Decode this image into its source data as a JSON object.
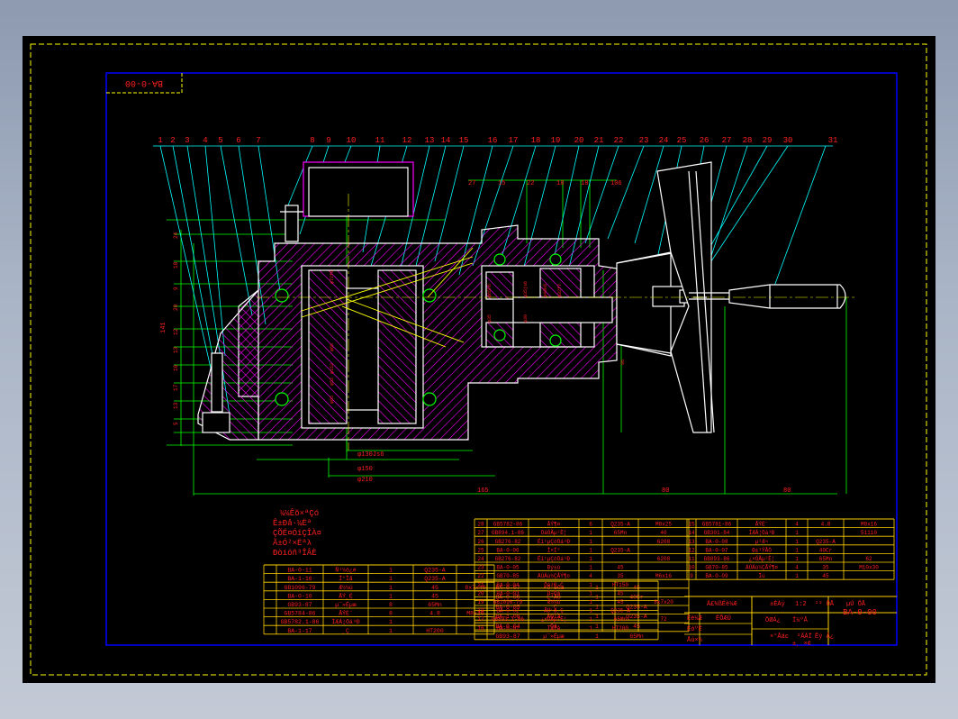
{
  "drawing": {
    "code_stamp": "BA-0-00",
    "code_block": "BA-0-00",
    "callouts": [
      "1",
      "2",
      "3",
      "4",
      "5",
      "6",
      "7",
      "8",
      "9",
      "10",
      "11",
      "12",
      "13",
      "14",
      "15",
      "16",
      "17",
      "18",
      "19",
      "20",
      "21",
      "22",
      "23",
      "24",
      "25",
      "26",
      "27",
      "28",
      "29",
      "30",
      "31"
    ],
    "dims_bottom": [
      "φ130Js6",
      "φ150",
      "φ210",
      "165",
      "80",
      "80"
    ],
    "dims_top": [
      "27",
      "15",
      "22",
      "18",
      "18",
      "106"
    ],
    "dims_left": [
      "24",
      "18",
      "9",
      "20",
      "12",
      "13",
      "16",
      "17",
      "13",
      "5"
    ],
    "dim_side_total": "141",
    "dims_inner": [
      "φ72f8",
      "φ66",
      "φ152",
      "φ52",
      "φ65",
      "φ65h6",
      "φ35js6",
      "φ40k6",
      "φ32f7",
      "φ35",
      "φ30",
      "96"
    ],
    "garbled_note": [
      "¼¼Êõ×ªÇó",
      "Ê±Ðå·¼Ëª",
      "ÇÕÉ¤ÓîÇÎÀ¤",
      "Ã±Ó²×Ëªλ",
      "Ðòíöñ³ÎÂÈ"
    ],
    "bom_right_a": [
      [
        "28",
        "GB5782-86",
        "ÂÝ¶¤",
        "6",
        "Q235-A",
        "M8x25"
      ],
      [
        "27",
        "GB894.1-86",
        "ÖáÓÃµ²È¦",
        "1",
        "65Mn",
        "40"
      ],
      [
        "26",
        "GB276-82",
        "Éî¹µÇòÖá³Ð",
        "1",
        "",
        "6208"
      ],
      [
        "25",
        "BA-0-06",
        "Ì×Í²",
        "1",
        "Q235-A",
        ""
      ],
      [
        "24",
        "GB276-82",
        "Éî¹µÇòÖá³Ð",
        "1",
        "",
        "6208"
      ],
      [
        "23",
        "BA-0-05",
        "Ðý±ú",
        "1",
        "45",
        ""
      ],
      [
        "22",
        "GB70-85",
        "ÄÚÁù½ÇÂÝ¶¤",
        "4",
        "35",
        "M6x16"
      ],
      [
        "21",
        "BA-0-04",
        "Öá³Ð¸Ç",
        "1",
        "HT150",
        ""
      ],
      [
        "20",
        "BA-0-03",
        "Ö÷Öá",
        "1",
        "45",
        ""
      ],
      [
        "19",
        "GB1096-79",
        "Æ½¼ü",
        "1",
        "45",
        "8x7x20"
      ],
      [
        "18",
        "BA-0-02",
        "ÃÜ·â¸Ç",
        "1",
        "Q235-A",
        ""
      ],
      [
        "17",
        "GB893.1-86",
        "¿×ÓÃµ²È¦",
        "1",
        "65Mn",
        "72"
      ],
      [
        "16",
        "BA-0-01",
        "ÏäÌå",
        "1",
        "HT200",
        ""
      ]
    ],
    "bom_right_b": [
      [
        "15",
        "GB5781-86",
        "ÂÝË¨",
        "4",
        "4.8",
        "M8x16"
      ],
      [
        "14",
        "GB301-84",
        "ÍÆÁ¦Öá³Ð",
        "1",
        "",
        "51110"
      ],
      [
        "13",
        "BA-0-08",
        "µ²Æ¬",
        "1",
        "Q235-A",
        ""
      ],
      [
        "12",
        "BA-0-07",
        "Ð±³ÝÂÖ",
        "1",
        "40Cr",
        ""
      ],
      [
        "11",
        "GB893-86",
        "¿×ÓÃµ²È¦",
        "1",
        "65Mn",
        "62"
      ],
      [
        "10",
        "GB70-85",
        "ÄÚÁù½ÇÂÝ¶¤",
        "4",
        "35",
        "M10x30"
      ],
      [
        "9",
        "BA-0-09",
        "Ïú",
        "1",
        "45",
        ""
      ]
    ],
    "bom_left": [
      [
        "",
        "BA-0-11",
        "Ñ¹½ô¿é",
        "1",
        "Q235-A",
        ""
      ],
      [
        "",
        "BA-1-16",
        "Í°Ìå",
        "1",
        "Q235-A",
        ""
      ],
      [
        "",
        "GB1096-79",
        "Æ½¼ü",
        "1",
        "45",
        "8x7x40"
      ],
      [
        "",
        "BA-0-10",
        "ÂÝ¸Ë",
        "1",
        "45",
        ""
      ],
      [
        "",
        "GB93-87",
        "µ¯»Éµæ",
        "8",
        "65Mn",
        ""
      ],
      [
        "",
        "GB5784-86",
        "ÂÝË¨",
        "8",
        "4.8",
        "M8x20"
      ],
      [
        "",
        "GB5782.1-86",
        "ÍÆÁ¦Öá³Ð",
        "1",
        "",
        ""
      ],
      [
        "",
        "BA-1-17",
        "¸Ç",
        "1",
        "HT200",
        ""
      ]
    ],
    "bom_mid": [
      [
        "",
        "BA-0-07",
        "×ó°ëÖá",
        "1",
        "45",
        ""
      ],
      [
        "",
        "BA-0-06",
        "Ë³ÂÖ",
        "1",
        "40Cr",
        ""
      ],
      [
        "",
        "BA-0-05",
        "¸Ç",
        "1",
        "Q235-A",
        ""
      ],
      [
        "",
        "BA-1-06",
        "ÂÖÌå",
        "1",
        "Q235-A",
        ""
      ],
      [
        "",
        "BA-0-04",
        "Öá",
        "1",
        "45",
        ""
      ],
      [
        "",
        "GB93-87",
        "µ¯»Éµæ",
        "1",
        "65Mn",
        ""
      ]
    ],
    "title_block": [
      "Ä£¾ßÉè¼Æ",
      "±ÈÀý",
      "1:2",
      "¹²  ÕÅ",
      "µÚ  ÕÅ",
      "Éè¼Æ",
      "ÉóºË",
      "Åú×¼",
      "ÈÕÆÚ",
      "ÖØÁ¿",
      "Í¼ºÅ",
      "BA-0-00",
      "×°Åäͼ",
      "²ÄÁÏ",
      "Êý Á¿",
      "±¸ ×¢"
    ]
  },
  "colors": {
    "background": "#000000",
    "frame_yellow": "#ffff00",
    "border_blue": "#0000ff",
    "section_magenta": "#ff00ff",
    "dim_green": "#00ff00",
    "text_red": "#ff2020",
    "leader_cyan": "#00ffff",
    "edge_white": "#ffffff",
    "table_yellow": "#ffd000"
  }
}
